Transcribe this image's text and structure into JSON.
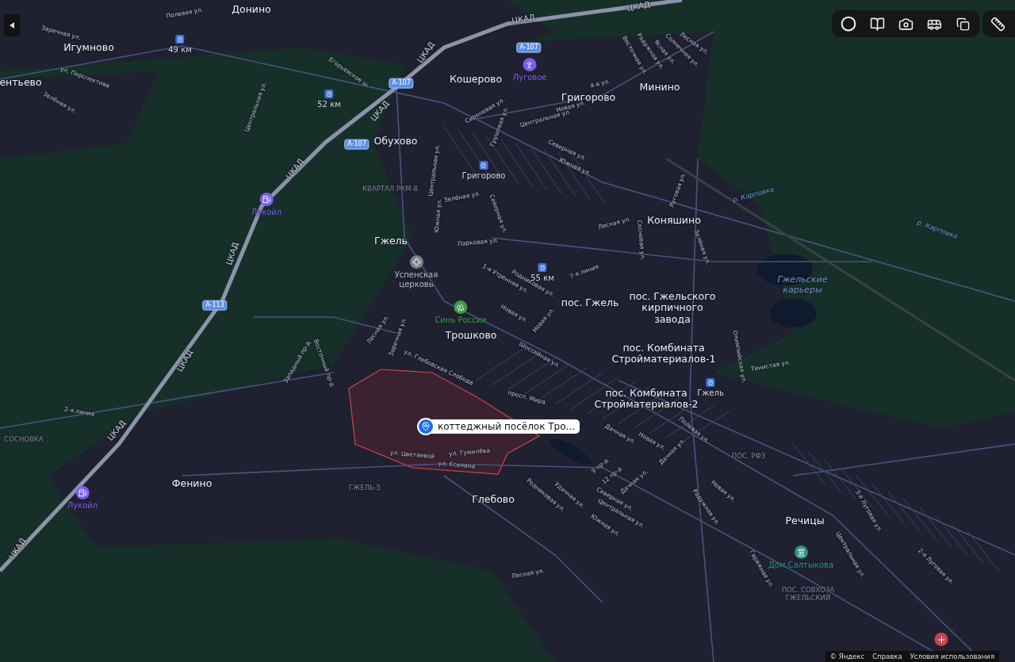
{
  "places": [
    {
      "label": "Донино"
    },
    {
      "label": "Игумново"
    },
    {
      "label": "ентьево"
    },
    {
      "label": "Кошерово"
    },
    {
      "label": "Григорово"
    },
    {
      "label": "Минино"
    },
    {
      "label": "Обухово"
    },
    {
      "label": "Коняшино"
    },
    {
      "label": "Гжель"
    },
    {
      "label": "Трошково"
    },
    {
      "label": "пос. Гжель"
    },
    {
      "label": "пос. Гжельского кирпичного завода"
    },
    {
      "label": "пос. Комбината Стройматериалов-1"
    },
    {
      "label": "пос. Комбината Стройматериалов-2"
    },
    {
      "label": "Фенино"
    },
    {
      "label": "Глебово"
    },
    {
      "label": "Речицы"
    }
  ],
  "districts": [
    {
      "label": "КВАРТАЛ РКМ-8"
    },
    {
      "label": "СОСНОВКА"
    },
    {
      "label": "ГЖЕЛЬ-5"
    },
    {
      "label": "ПОС. РФЗ"
    },
    {
      "label": "ПОС. СОВХОЗА ГЖЕЛЬСКИЙ"
    }
  ],
  "water": [
    {
      "label": "Гжельские карьеры"
    },
    {
      "label": "р. Карповка"
    },
    {
      "label": "р. Карповка"
    }
  ],
  "stations": [
    {
      "label": "49 км"
    },
    {
      "label": "52 км"
    },
    {
      "label": "Григорово"
    },
    {
      "label": "55 км"
    },
    {
      "label": "Гжель"
    }
  ],
  "pois": [
    {
      "kind": "sport",
      "label": "Луговое",
      "color": "#7b5cf0"
    },
    {
      "kind": "fuel",
      "label": "Лукойл",
      "color": "#7b5cf0"
    },
    {
      "kind": "fuel",
      "label": "Лукойл",
      "color": "#7b5cf0"
    },
    {
      "kind": "church",
      "label": "Успенская церковь",
      "color": "#7d7f86"
    },
    {
      "kind": "park",
      "label": "Синь России",
      "color": "#3e9a4a"
    },
    {
      "kind": "museum",
      "label": "Дом Салтыкова",
      "color": "#2e8f86"
    },
    {
      "kind": "hospital",
      "color": "#c9444c"
    }
  ],
  "shields": [
    {
      "label": "A-107"
    },
    {
      "label": "A-107"
    },
    {
      "label": "A-107"
    },
    {
      "label": "A-113"
    }
  ],
  "highway_labels": [
    {
      "label": "ЦКАД"
    },
    {
      "label": "ЦКАД"
    },
    {
      "label": "ЦКАД"
    },
    {
      "label": "ЦКАД"
    },
    {
      "label": "ЦКАД"
    },
    {
      "label": "ЦКАД"
    },
    {
      "label": "ЦКАД"
    },
    {
      "label": "ЦКАД"
    },
    {
      "label": "ЦКАД"
    }
  ],
  "streets": [
    {
      "label": "Полевая ул."
    },
    {
      "label": "Заречная ул."
    },
    {
      "label": "ул. Перспектива"
    },
    {
      "label": "Зелёная ул."
    },
    {
      "label": "Егорьевское ш."
    },
    {
      "label": "Центральная ул."
    },
    {
      "label": "Восточная ул."
    },
    {
      "label": "Радужная ул."
    },
    {
      "label": "Ясная ул."
    },
    {
      "label": "Солнечная ул."
    },
    {
      "label": "Лесная ул."
    },
    {
      "label": "4-я ул."
    },
    {
      "label": "Новая ул."
    },
    {
      "label": "Центральная ул."
    },
    {
      "label": "Сиреневая ул."
    },
    {
      "label": "Грушовая ул."
    },
    {
      "label": "Северная ул."
    },
    {
      "label": "Южная ул."
    },
    {
      "label": "Центральная ул."
    },
    {
      "label": "Зелёная ул."
    },
    {
      "label": "Южная ул."
    },
    {
      "label": "Северная ул."
    },
    {
      "label": "Парковая ул."
    },
    {
      "label": "Луговая ул."
    },
    {
      "label": "Лесная ул."
    },
    {
      "label": "Сосновая ул."
    },
    {
      "label": "Зелёная ул."
    },
    {
      "label": "7-я линия"
    },
    {
      "label": "1-я Утренняя ул."
    },
    {
      "label": "Родниковая ул."
    },
    {
      "label": "Новая ул."
    },
    {
      "label": "Новая ул."
    },
    {
      "label": "Лесная ул."
    },
    {
      "label": "Заречная ул."
    },
    {
      "label": "ул. Глебовская Слобода"
    },
    {
      "label": "Шоссейная ул."
    },
    {
      "label": "Западный пр-д"
    },
    {
      "label": "Восточный пр-д"
    },
    {
      "label": "Олимпийская ул."
    },
    {
      "label": "Тенистая ул."
    },
    {
      "label": "просп. Мира"
    },
    {
      "label": "2-я линия"
    },
    {
      "label": "Полевая ул."
    },
    {
      "label": "Дачная ул."
    },
    {
      "label": "Новая ул."
    },
    {
      "label": "Дачная ул."
    },
    {
      "label": "9 пр-д"
    },
    {
      "label": "12 пр-д"
    },
    {
      "label": "Дачная ул."
    },
    {
      "label": "ул. Цветаевой"
    },
    {
      "label": "ул. Гумилёва"
    },
    {
      "label": "ул. Есенина"
    },
    {
      "label": "Удачная ул."
    },
    {
      "label": "Северная ул."
    },
    {
      "label": "Родниковая ул."
    },
    {
      "label": "Центральная ул."
    },
    {
      "label": "Южная ул."
    },
    {
      "label": "Лесная ул."
    },
    {
      "label": "Новая ул."
    },
    {
      "label": "Радужная ул."
    },
    {
      "label": "3-я Луговая ул."
    },
    {
      "label": "Гаражная ул."
    },
    {
      "label": "Центральная ул."
    },
    {
      "label": "2-я Луговая ул."
    }
  ],
  "pin": {
    "label": "коттеджный посёлок Тро..."
  },
  "footer": {
    "copyright": "© Яндекс",
    "links": [
      "Справка",
      "Условия использования"
    ]
  }
}
